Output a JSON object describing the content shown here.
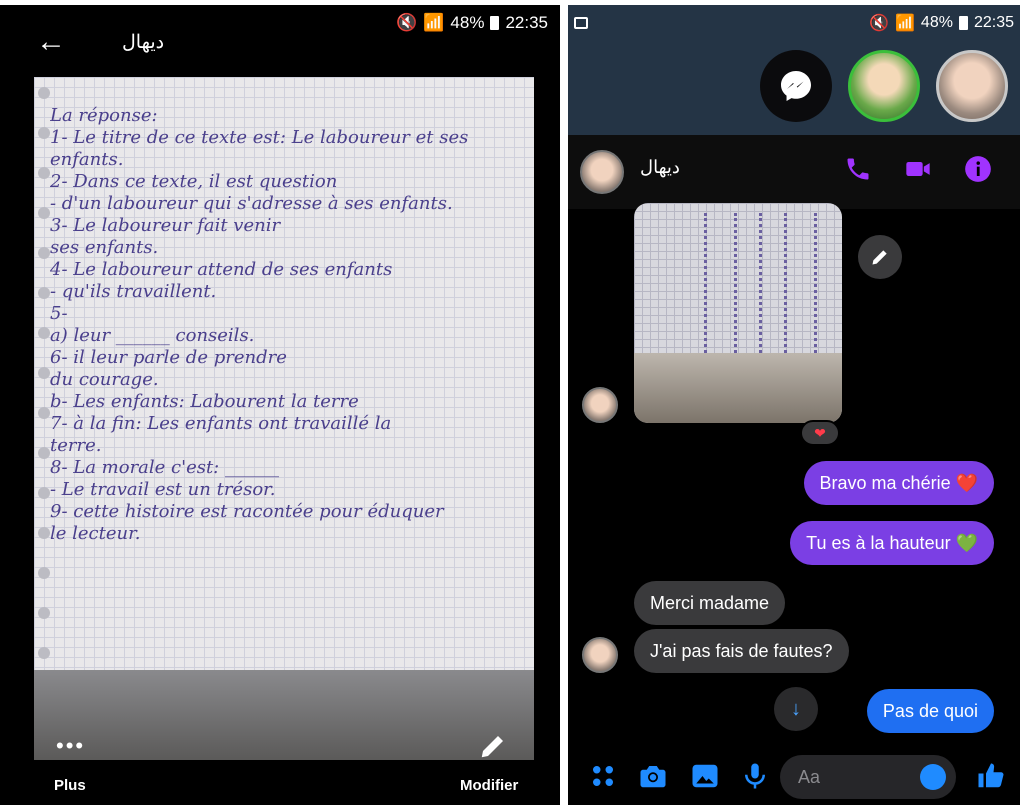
{
  "left": {
    "status": {
      "battery": "48%",
      "time": "22:35"
    },
    "title": "ديهال",
    "handwriting": [
      "La réponse:",
      "1- Le titre de ce texte est: Le laboureur et ses",
      "enfants.",
      "2- Dans ce texte, il est question",
      "- d'un laboureur qui s'adresse à ses enfants.",
      "3- Le laboureur fait venir",
      "ses enfants.",
      "4- Le laboureur attend de ses enfants",
      "- qu'ils travaillent.",
      "5-",
      "a) leur ______ conseils.",
      "6- il leur parle de prendre",
      "du courage.",
      "b- Les enfants: Labourent la terre",
      "7- à la fin: Les enfants ont travaillé la",
      "terre.",
      "8- La morale c'est: ______",
      "- Le travail est un trésor.",
      "9- cette histoire est racontée pour éduquer",
      "le lecteur."
    ],
    "more_glyph": "•••",
    "more_label": "Plus",
    "edit_label": "Modifier"
  },
  "right": {
    "status": {
      "battery": "48%",
      "time": "22:35"
    },
    "contact_name": "ديهال",
    "reaction": "❤",
    "messages": [
      {
        "text": "Bravo ma chérie ❤️"
      },
      {
        "text": "Tu es à la hauteur 💚"
      },
      {
        "text": "Merci madame"
      },
      {
        "text": "J'ai pas fais de fautes?"
      },
      {
        "text": "Pas de quoi"
      }
    ],
    "input_placeholder": "Aa",
    "scroll_down_glyph": "↓"
  },
  "colors": {
    "accent_purple": "#7b3fe4",
    "accent_blue": "#1f6ff2",
    "icon_purple": "#a033ff",
    "icon_blue": "#1f8bff"
  }
}
